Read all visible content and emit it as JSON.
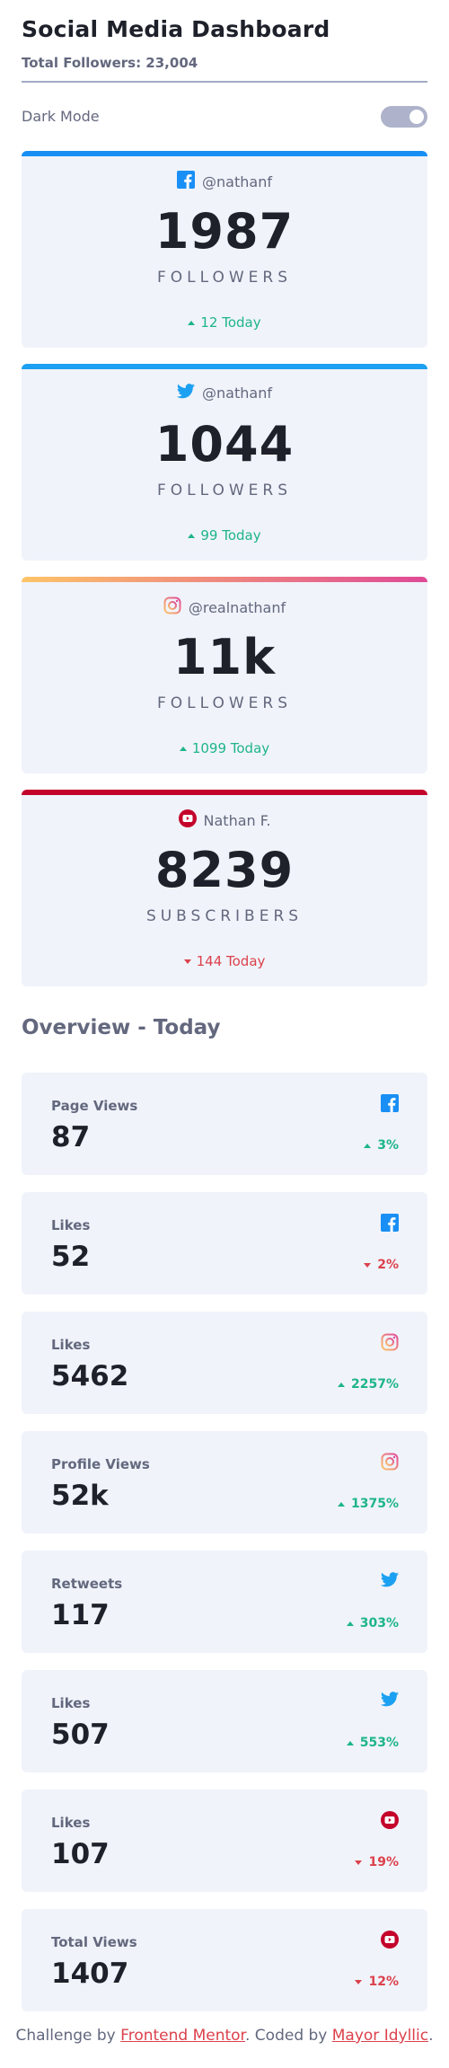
{
  "header": {
    "title": "Social Media Dashboard",
    "total_followers": "Total Followers: 23,004"
  },
  "mode": {
    "label": "Dark Mode",
    "enabled": false
  },
  "cards": [
    {
      "network": "facebook",
      "icon": "facebook-icon",
      "handle": "@nathanf",
      "count": "1987",
      "unit": "FOLLOWERS",
      "change": "12 Today",
      "direction": "up"
    },
    {
      "network": "twitter",
      "icon": "twitter-icon",
      "handle": "@nathanf",
      "count": "1044",
      "unit": "FOLLOWERS",
      "change": "99 Today",
      "direction": "up"
    },
    {
      "network": "instagram",
      "icon": "instagram-icon",
      "handle": "@realnathanf",
      "count": "11k",
      "unit": "FOLLOWERS",
      "change": "1099 Today",
      "direction": "up"
    },
    {
      "network": "youtube",
      "icon": "youtube-icon",
      "handle": "Nathan F.",
      "count": "8239",
      "unit": "SUBSCRIBERS",
      "change": "144 Today",
      "direction": "down"
    }
  ],
  "overview": {
    "title": "Overview - Today",
    "items": [
      {
        "label": "Page Views",
        "value": "87",
        "network": "facebook",
        "change": "3%",
        "direction": "up"
      },
      {
        "label": "Likes",
        "value": "52",
        "network": "facebook",
        "change": "2%",
        "direction": "down"
      },
      {
        "label": "Likes",
        "value": "5462",
        "network": "instagram",
        "change": "2257%",
        "direction": "up"
      },
      {
        "label": "Profile Views",
        "value": "52k",
        "network": "instagram",
        "change": "1375%",
        "direction": "up"
      },
      {
        "label": "Retweets",
        "value": "117",
        "network": "twitter",
        "change": "303%",
        "direction": "up"
      },
      {
        "label": "Likes",
        "value": "507",
        "network": "twitter",
        "change": "553%",
        "direction": "up"
      },
      {
        "label": "Likes",
        "value": "107",
        "network": "youtube",
        "change": "19%",
        "direction": "down"
      },
      {
        "label": "Total Views",
        "value": "1407",
        "network": "youtube",
        "change": "12%",
        "direction": "down"
      }
    ]
  },
  "footer": {
    "prefix": "Challenge by ",
    "link1": "Frontend Mentor",
    "middle": ". Coded by ",
    "link2": "Mayor Idyllic",
    "suffix": "."
  },
  "colors": {
    "up": "#1eb589",
    "down": "#dc414c",
    "facebook": "#198ff5",
    "twitter": "#1ca0f2",
    "youtube": "#c4032b"
  }
}
